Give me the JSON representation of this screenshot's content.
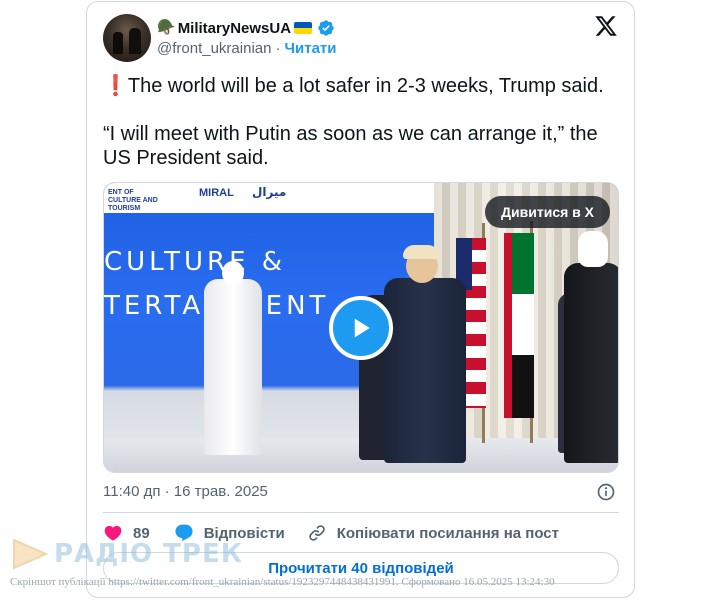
{
  "tweet": {
    "author": {
      "name": "MilitaryNewsUA",
      "handle": "@front_ukrainian",
      "name_emoji": "🪖",
      "separator": "·",
      "follow_label": "Читати",
      "verified": true
    },
    "text_line1_mark": "❗",
    "text_line1": "The world will be a lot safer in 2-3 weeks, Trump said.",
    "text_line2": "“I will meet with Putin as soon as we can arrange it,” the US President said.",
    "media": {
      "watch_label": "Дивитися в X",
      "banner_left": "ENT OF CULTURE AND TOURISM",
      "banner_brand": "MIRAL",
      "banner_arabic": "ميرال",
      "wall_text_1": "CULTURE &",
      "wall_text_2": "TERTAINMENT"
    },
    "timestamp": "11:40 дп · 16 трав. 2025",
    "actions": {
      "likes": "89",
      "reply_label": "Відповісти",
      "copy_link_label": "Копіювати посилання на пост"
    },
    "read_replies_label": "Прочитати 40 відповідей"
  },
  "overlay": {
    "logo_text": "РАДІО ТРЕК",
    "footer_note": "Скріншот публікації https://twitter.com/front_ukrainian/status/1923297448438431991. Сформовано 16.05.2025 13:24:30"
  },
  "colors": {
    "accent": "#1d9bf0",
    "link": "#006fd6",
    "like": "#f91880",
    "muted": "#536471",
    "border": "#cfd9de"
  }
}
